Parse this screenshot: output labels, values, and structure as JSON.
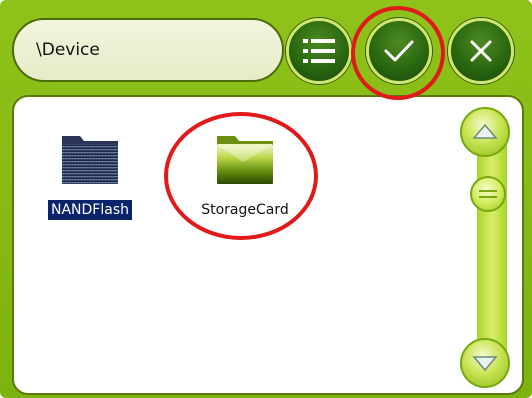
{
  "toolbar": {
    "path": "\\Device",
    "buttons": [
      {
        "icon": "list-icon"
      },
      {
        "icon": "checkmark-icon"
      },
      {
        "icon": "close-icon"
      }
    ]
  },
  "files": [
    {
      "name": "NANDFlash",
      "icon": "folder-icon",
      "selected": true
    },
    {
      "name": "StorageCard",
      "icon": "folder-icon",
      "selected": false
    }
  ],
  "scrollbar": {
    "up_icon": "triangle-up-icon",
    "thumb_icon": "grip-lines-icon",
    "down_icon": "triangle-down-icon"
  },
  "colors": {
    "frame": "#8fc21a",
    "button": "#2a6810",
    "annotation": "#e01a1a",
    "selection": "#0a236a"
  }
}
